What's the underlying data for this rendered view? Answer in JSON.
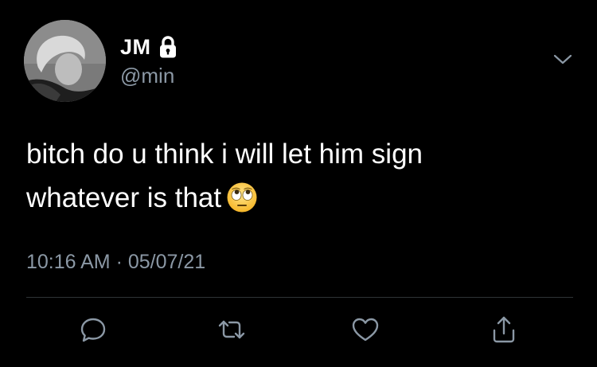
{
  "user": {
    "display_name": "JM",
    "handle": "@min",
    "avatar_icon": "profile-photo",
    "protected_icon": "lock-icon"
  },
  "tweet": {
    "text_line1": "bitch do u think i will let him sign",
    "text_line2": "whatever is that",
    "emoji": "face-with-rolling-eyes",
    "time": "10:16 AM",
    "separator": "·",
    "date": "05/07/21"
  },
  "actions": [
    {
      "icon": "reply-icon"
    },
    {
      "icon": "retweet-icon"
    },
    {
      "icon": "like-icon"
    },
    {
      "icon": "share-icon"
    }
  ],
  "colors": {
    "background": "#000000",
    "text": "#ffffff",
    "secondary_text": "#8b98a5",
    "divider": "#2f3336"
  }
}
